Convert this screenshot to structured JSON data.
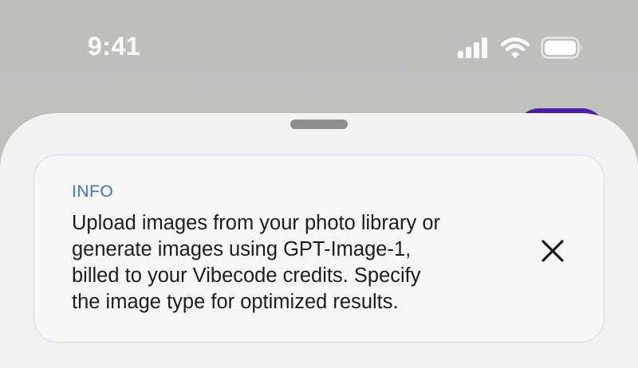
{
  "status_bar": {
    "time": "9:41",
    "icons": [
      "cellular-signal-icon",
      "wifi-icon",
      "battery-icon"
    ]
  },
  "info_card": {
    "label": "INFO",
    "message": "Upload images from your photo library or\ngenerate images using GPT-Image-1,\nbilled to your Vibecode credits. Specify\nthe image type for optimized results.",
    "close_icon": "close-icon"
  },
  "colors": {
    "accent_label": "#3d72d9",
    "card_border": "#d3dcf0",
    "sheet_background": "#f2f2f0",
    "purple_peek": "#4a1fa8"
  }
}
